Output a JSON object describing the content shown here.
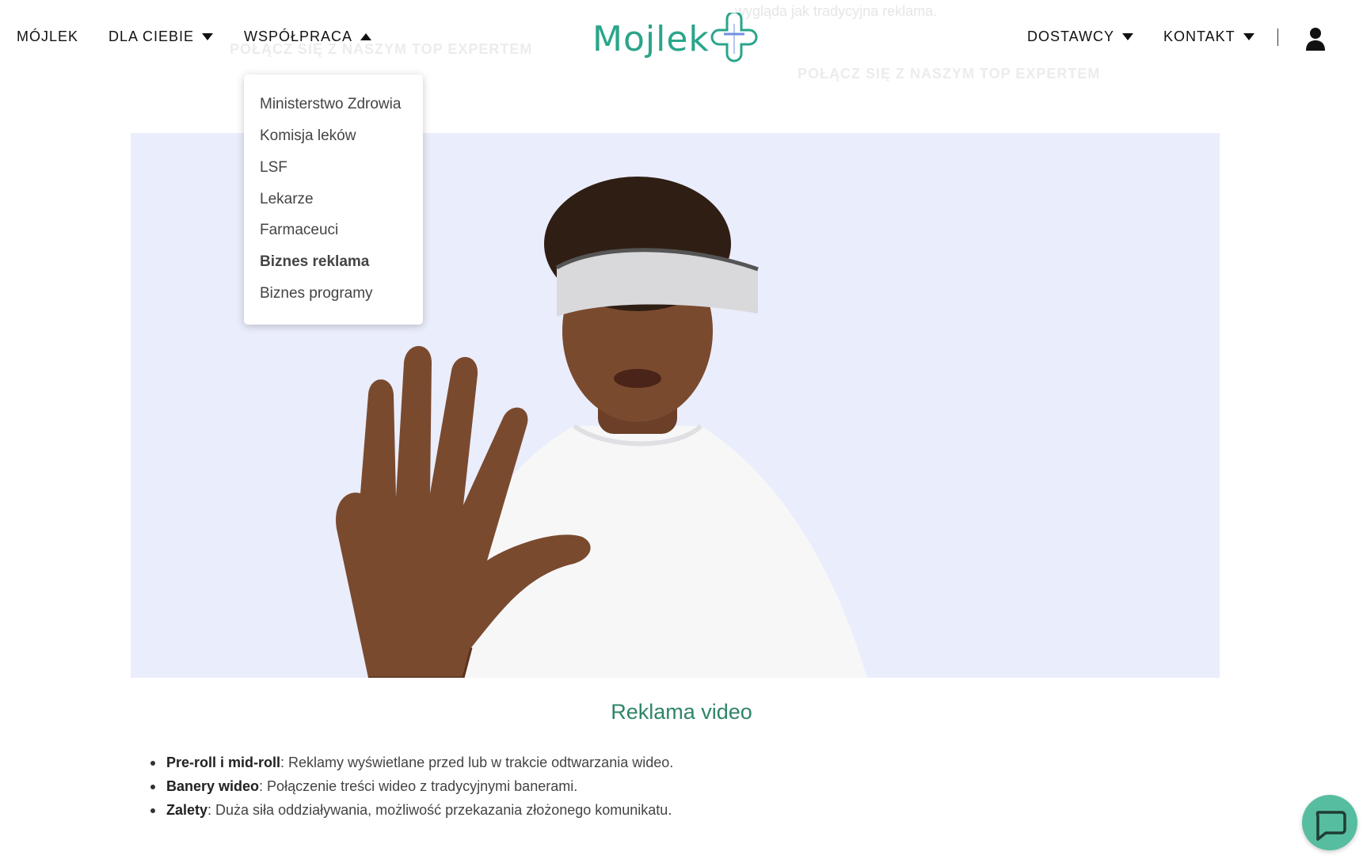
{
  "background_text": {
    "cta_left": "POŁĄCZ SIĘ Z NASZYM TOP EXPERTEM",
    "cta_right": "POŁĄCZ SIĘ Z NASZYM TOP EXPERTEM",
    "snippet": "wygląda jak tradycyjna reklama."
  },
  "header": {
    "nav_left": [
      {
        "label": "MÓJLEK"
      },
      {
        "label": "DLA CIEBIE"
      },
      {
        "label": "WSPÓŁPRACA"
      }
    ],
    "logo_text": "Mojlek",
    "nav_right": [
      {
        "label": "DOSTAWCY"
      },
      {
        "label": "KONTAKT"
      }
    ],
    "separator": "|",
    "user_icon": "user-icon"
  },
  "dropdown": {
    "items": [
      {
        "label": "Ministerstwo Zdrowia"
      },
      {
        "label": "Komisja leków"
      },
      {
        "label": "LSF"
      },
      {
        "label": "Lekarze"
      },
      {
        "label": "Farmaceuci"
      },
      {
        "label": "Biznes reklama",
        "active": true
      },
      {
        "label": "Biznes programy"
      }
    ]
  },
  "section": {
    "title": "Reklama video",
    "bullets": [
      {
        "bold": "Pre-roll i mid-roll",
        "text": ": Reklamy wyświetlane przed lub w trakcie odtwarzania wideo."
      },
      {
        "bold": "Banery wideo",
        "text": ": Połączenie treści wideo z tradycyjnymi banerami."
      },
      {
        "bold": "Zalety",
        "text": ": Duża siła oddziaływania, możliwość przekazania złożonego komunikatu."
      }
    ]
  },
  "colors": {
    "brand_green": "#2aa58a",
    "brand_blue": "#6f8fe0",
    "hero_bg": "#eaedfb",
    "chat_button": "#57bda0"
  },
  "chat_icon": "chat-bubble-icon"
}
